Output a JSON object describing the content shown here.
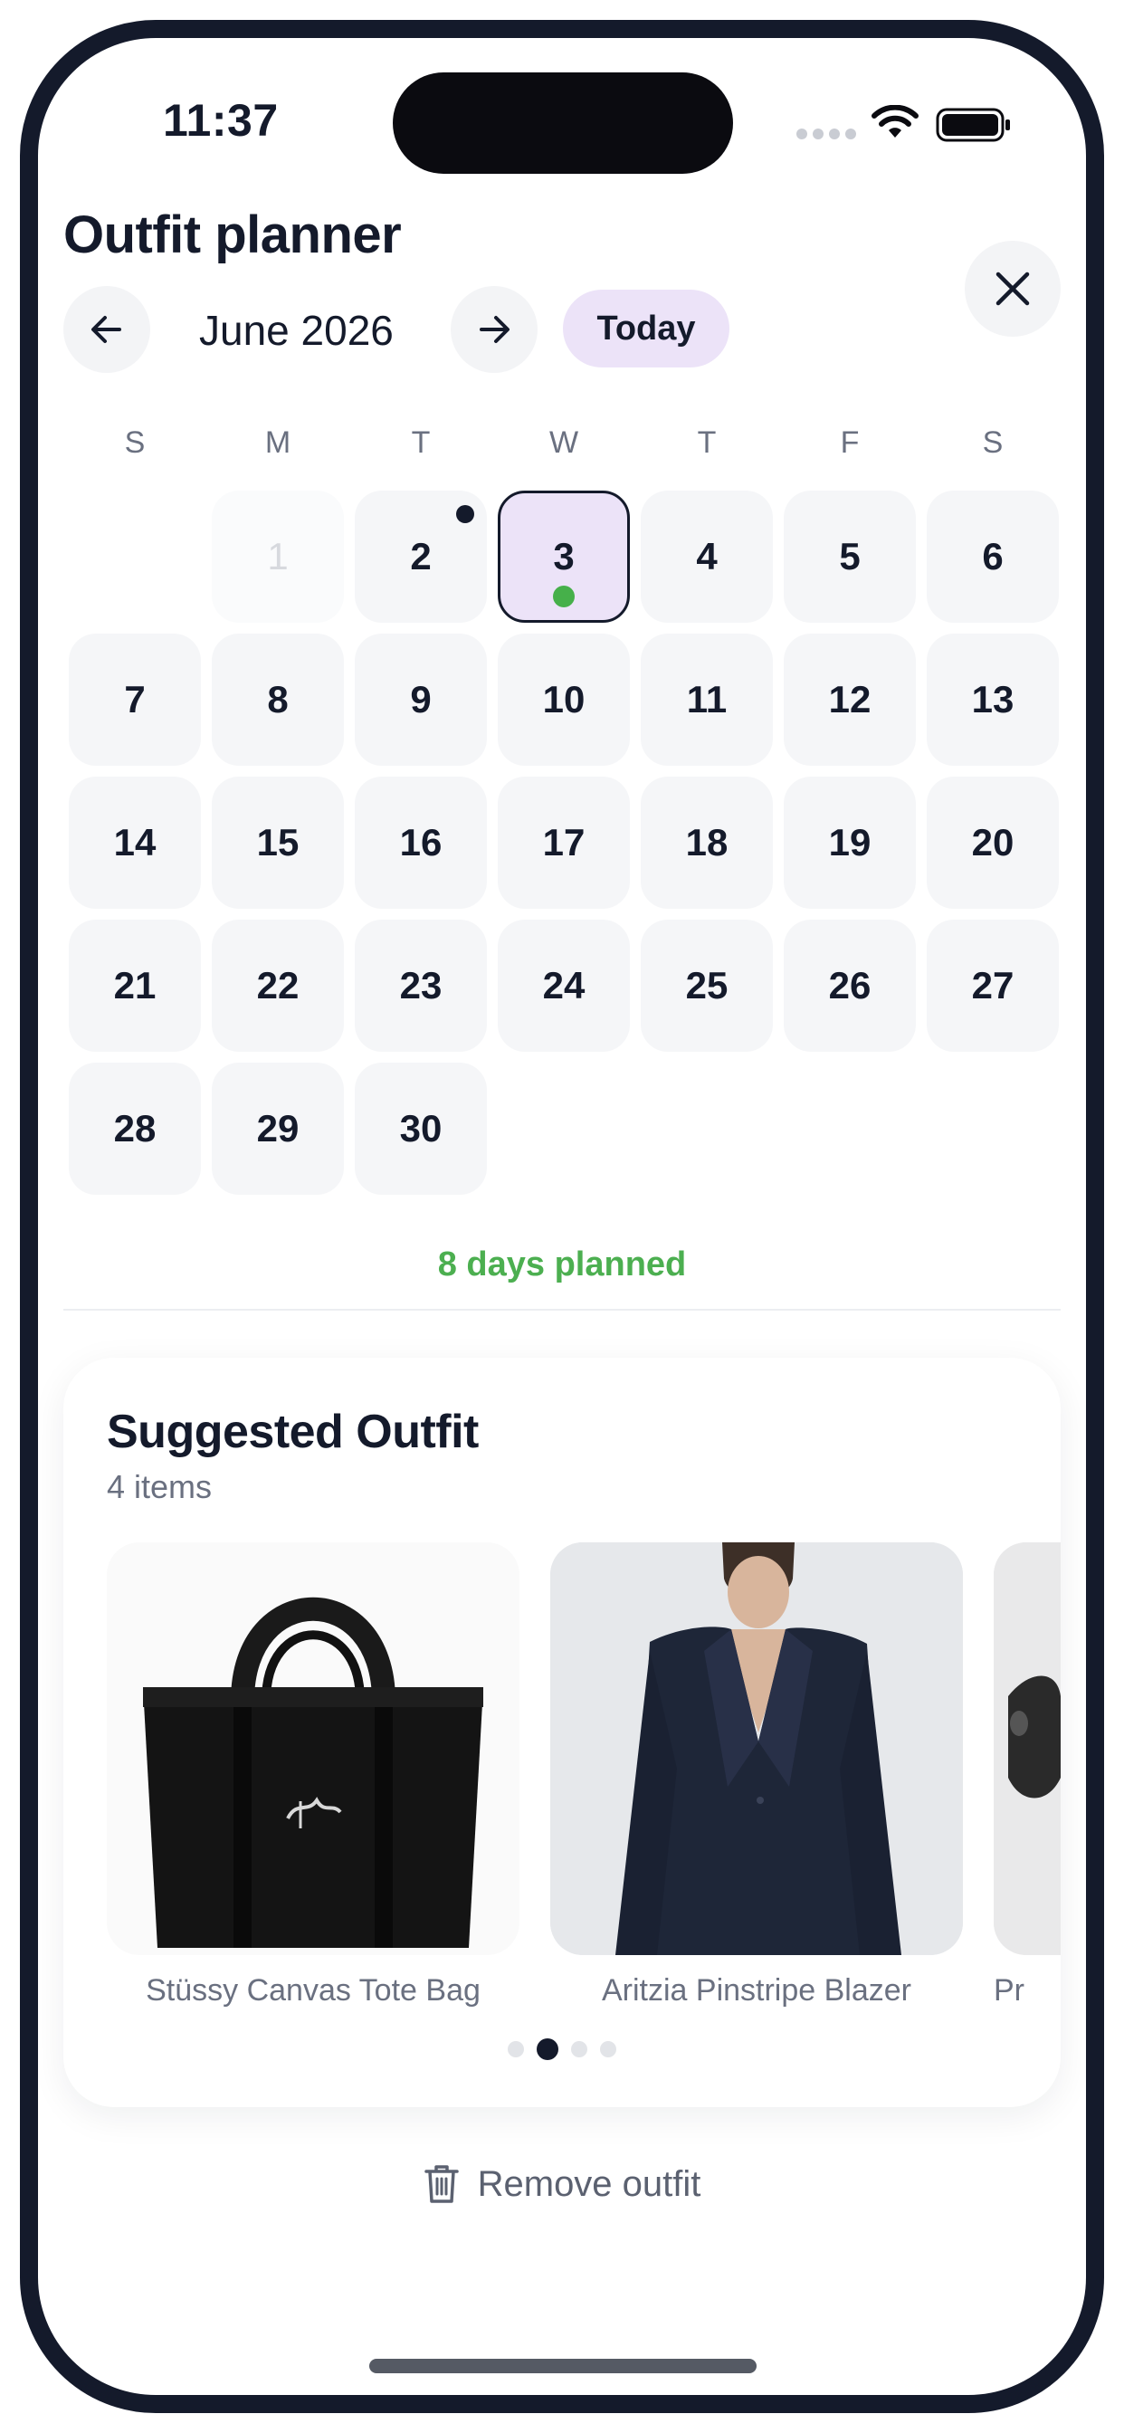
{
  "status_bar": {
    "time": "11:37"
  },
  "header": {
    "title": "Outfit planner"
  },
  "nav": {
    "month": "June 2026",
    "today_label": "Today"
  },
  "calendar": {
    "weekdays": [
      "S",
      "M",
      "T",
      "W",
      "T",
      "F",
      "S"
    ],
    "days": [
      {
        "label": "1",
        "muted": true
      },
      {
        "label": "2",
        "has_dot": true
      },
      {
        "label": "3",
        "selected": true,
        "planned": true
      },
      {
        "label": "4"
      },
      {
        "label": "5"
      },
      {
        "label": "6"
      },
      {
        "label": "7"
      },
      {
        "label": "8"
      },
      {
        "label": "9"
      },
      {
        "label": "10"
      },
      {
        "label": "11"
      },
      {
        "label": "12"
      },
      {
        "label": "13"
      },
      {
        "label": "14"
      },
      {
        "label": "15"
      },
      {
        "label": "16"
      },
      {
        "label": "17"
      },
      {
        "label": "18"
      },
      {
        "label": "19"
      },
      {
        "label": "20"
      },
      {
        "label": "21"
      },
      {
        "label": "22"
      },
      {
        "label": "23"
      },
      {
        "label": "24"
      },
      {
        "label": "25"
      },
      {
        "label": "26"
      },
      {
        "label": "27"
      },
      {
        "label": "28"
      },
      {
        "label": "29"
      },
      {
        "label": "30"
      }
    ]
  },
  "summary": {
    "planned_text": "8 days planned"
  },
  "suggested": {
    "title": "Suggested Outfit",
    "subtitle": "4 items",
    "items": [
      {
        "label": "Stüssy Canvas Tote Bag"
      },
      {
        "label": "Aritzia Pinstripe Blazer"
      },
      {
        "label": "Pr"
      }
    ],
    "pager": {
      "count": 4,
      "active": 1
    }
  },
  "actions": {
    "remove_label": "Remove outfit"
  },
  "icons": {
    "back": "arrow-left-icon",
    "forward": "arrow-right-icon",
    "close": "close-icon",
    "remove": "trash-icon",
    "wifi": "wifi-icon",
    "battery": "battery-icon"
  },
  "colors": {
    "accent": "#ece3f8",
    "planned": "#4caf50",
    "ink": "#141a2b"
  }
}
